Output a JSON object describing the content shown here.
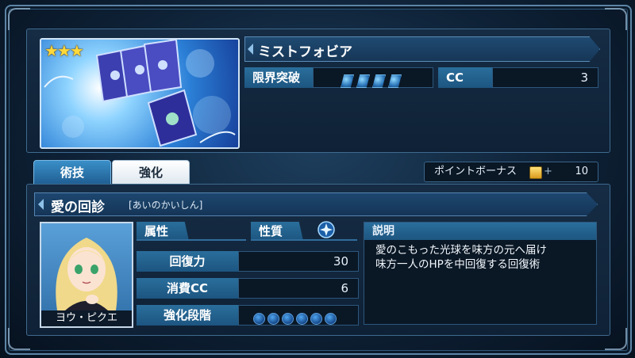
{
  "item": {
    "name": "ミストフォビア",
    "rarity_stars": "★★★",
    "limit_break_label": "限界突破",
    "limit_break_gems": 4,
    "cc_label": "CC",
    "cc_value": "3"
  },
  "tabs": {
    "skill": "術技",
    "enhance": "強化"
  },
  "point_bonus": {
    "label": "ポイントボーナス",
    "value": "+",
    "amount": "10"
  },
  "skill": {
    "name": "愛の回診",
    "reading": "[あいのかいしん]",
    "attribute_label": "属性",
    "nature_label": "性質",
    "stats": [
      {
        "label": "回復力",
        "value": "30"
      },
      {
        "label": "消費CC",
        "value": "6"
      },
      {
        "label": "強化段階",
        "value": ""
      }
    ],
    "enhance_level_slots": 6,
    "description_label": "説明",
    "description_lines": [
      "愛のこもった光球を味方の元へ届け",
      "味方一人のHPを中回復する回復術"
    ]
  },
  "character": {
    "name": "ヨウ・ピクエ"
  },
  "colors": {
    "accent": "#2a6e9c",
    "gem": "#4fa6f0",
    "star": "#ffd93a"
  }
}
